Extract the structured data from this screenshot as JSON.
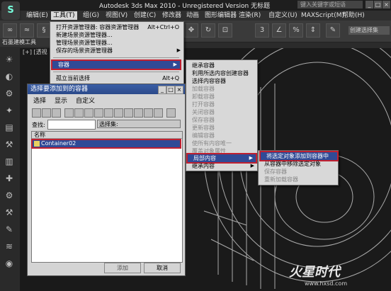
{
  "app": {
    "title": "Autodesk 3ds Max  2010  - Unregistered Version  无标题",
    "search_placeholder": "键入关键字或短语",
    "logo_text": "S"
  },
  "menubar": [
    {
      "label": "编辑(E)",
      "active": false
    },
    {
      "label": "工具(T)",
      "active": true
    },
    {
      "label": "组(G)",
      "active": false
    },
    {
      "label": "视图(V)",
      "active": false
    },
    {
      "label": "创建(C)",
      "active": false
    },
    {
      "label": "修改器",
      "active": false
    },
    {
      "label": "动画",
      "active": false
    },
    {
      "label": "图形编辑器",
      "active": false
    },
    {
      "label": "渲染(R)",
      "active": false
    },
    {
      "label": "自定义(U)",
      "active": false
    },
    {
      "label": "MAXScript(M)",
      "active": false
    },
    {
      "label": "帮助(H)",
      "active": false
    }
  ],
  "toolbar": {
    "selection_set_label": "创建选择集"
  },
  "viewport": {
    "label": "[+] [透视",
    "ribbon_label": "石墨建模工具"
  },
  "tools_menu": {
    "items": [
      {
        "label": "打开资源管理器: 容器资源管理器",
        "shortcut": "Alt+Ctrl+O"
      },
      {
        "label": "新建场景资源管理器..."
      },
      {
        "label": "管理场景资源管理器..."
      },
      {
        "label": "保存的场景资源管理器",
        "submenu": true
      },
      {
        "label": "容器",
        "submenu": true,
        "highlighted": true
      },
      {
        "label": "孤立当前选择",
        "shortcut": "Alt+Q"
      }
    ]
  },
  "container_menu": {
    "items": [
      {
        "label": "继承容器"
      },
      {
        "label": "利用所选内容创建容器"
      },
      {
        "label": "选择内容容器"
      },
      {
        "label": "加载容器",
        "disabled": true
      },
      {
        "label": "卸载容器",
        "disabled": true
      },
      {
        "label": "打开容器",
        "disabled": true
      },
      {
        "label": "关闭容器",
        "disabled": true
      },
      {
        "label": "保存容器",
        "disabled": true
      },
      {
        "label": "更新容器",
        "disabled": true
      },
      {
        "label": "编辑容器",
        "disabled": true
      },
      {
        "label": "使所有内容唯一",
        "disabled": true
      },
      {
        "label": "覆盖对象属性",
        "disabled": true
      },
      {
        "label": "局部内容",
        "submenu": true,
        "highlighted": true
      },
      {
        "label": "继承内容",
        "submenu": true
      }
    ]
  },
  "local_content_menu": {
    "items": [
      {
        "label": "将选定对象添加到容器中",
        "highlighted": true
      },
      {
        "label": "从容器中移除选定对象"
      },
      {
        "label": "保存容器",
        "disabled": true
      },
      {
        "label": "重新加载容器",
        "disabled": true
      }
    ]
  },
  "dialog": {
    "title": "选择要添加到的容器",
    "menus": [
      "选择",
      "显示",
      "自定义"
    ],
    "find_label": "查找:",
    "selection_set_label": "选择集:",
    "list_header": "名称",
    "list_items": [
      "Container02"
    ],
    "add_button": "添加",
    "cancel_button": "取消"
  },
  "watermark": {
    "text": "火星时代",
    "url": "www.hxsd.com"
  }
}
